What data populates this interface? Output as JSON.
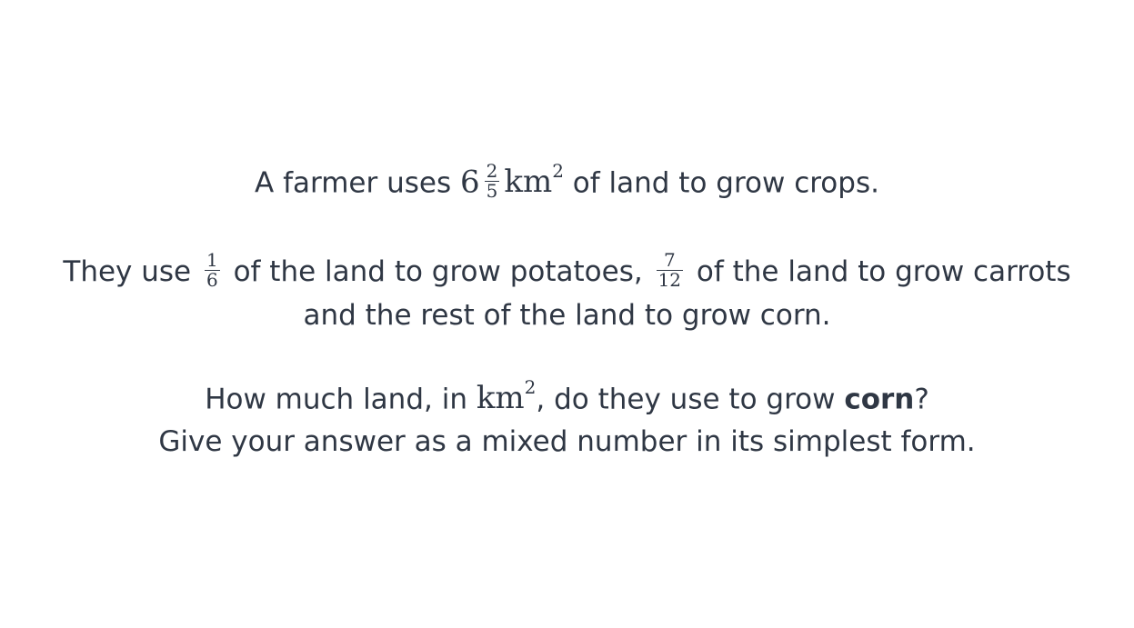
{
  "line1": {
    "before": "A farmer uses",
    "whole": "6",
    "num": "2",
    "den": "5",
    "unit": "km",
    "exp": "2",
    "after": "of land to grow crops."
  },
  "line2": {
    "before": "They use",
    "frac1_num": "1",
    "frac1_den": "6",
    "middle": "of the land to grow potatoes,",
    "frac2_num": "7",
    "frac2_den": "12",
    "after": "of the land to grow carrots"
  },
  "line3": {
    "text": "and the rest of the land to grow corn."
  },
  "line4": {
    "before": "How much land, in",
    "unit": "km",
    "exp": "2",
    "middle": ", do they use to grow",
    "bold": "corn",
    "after": "?"
  },
  "line5": {
    "text": "Give your answer as a mixed number in its simplest form."
  }
}
